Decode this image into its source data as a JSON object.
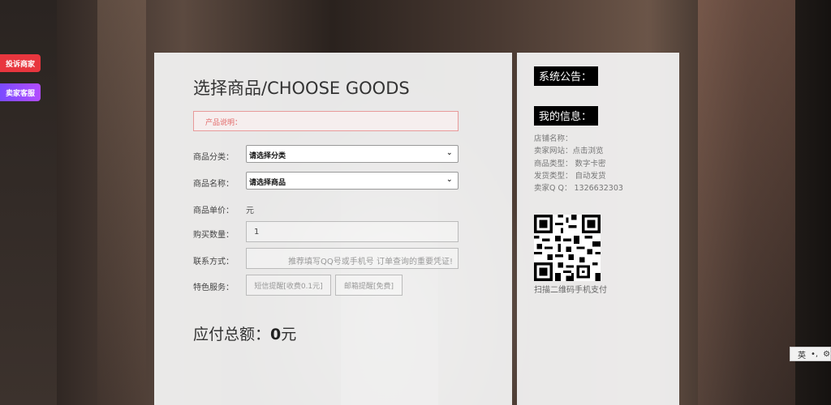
{
  "side_buttons": {
    "complain": "投诉商家",
    "service": "卖家客服"
  },
  "main": {
    "title": "选择商品/CHOOSE GOODS",
    "description_label": "产品说明：",
    "category": {
      "label": "商品分类：",
      "selected": "请选择分类"
    },
    "product": {
      "label": "商品名称：",
      "selected": "请选择商品"
    },
    "price": {
      "label": "商品单价：",
      "value": "元"
    },
    "quantity": {
      "label": "购买数量：",
      "value": "1"
    },
    "contact": {
      "label": "联系方式：",
      "placeholder": "推荐填写QQ号或手机号 订单查询的重要凭证!"
    },
    "special": {
      "label": "特色服务：",
      "sms": "短信提醒[收费0.1元]",
      "email": "邮箱提醒[免费]"
    },
    "total": {
      "label": "应付总额：",
      "amount": "0",
      "unit": "元"
    }
  },
  "sidebar": {
    "announcement_title": "系统公告：",
    "my_info_title": "我的信息：",
    "info_lines": [
      "店铺名称：",
      "卖家网站：点击浏览",
      "商品类型：   数字卡密",
      "发货类型：   自动发货",
      "卖家Q Q：   1326632303"
    ],
    "qr_caption": "扫描二维码手机支付"
  },
  "ime": {
    "lang": "英"
  }
}
